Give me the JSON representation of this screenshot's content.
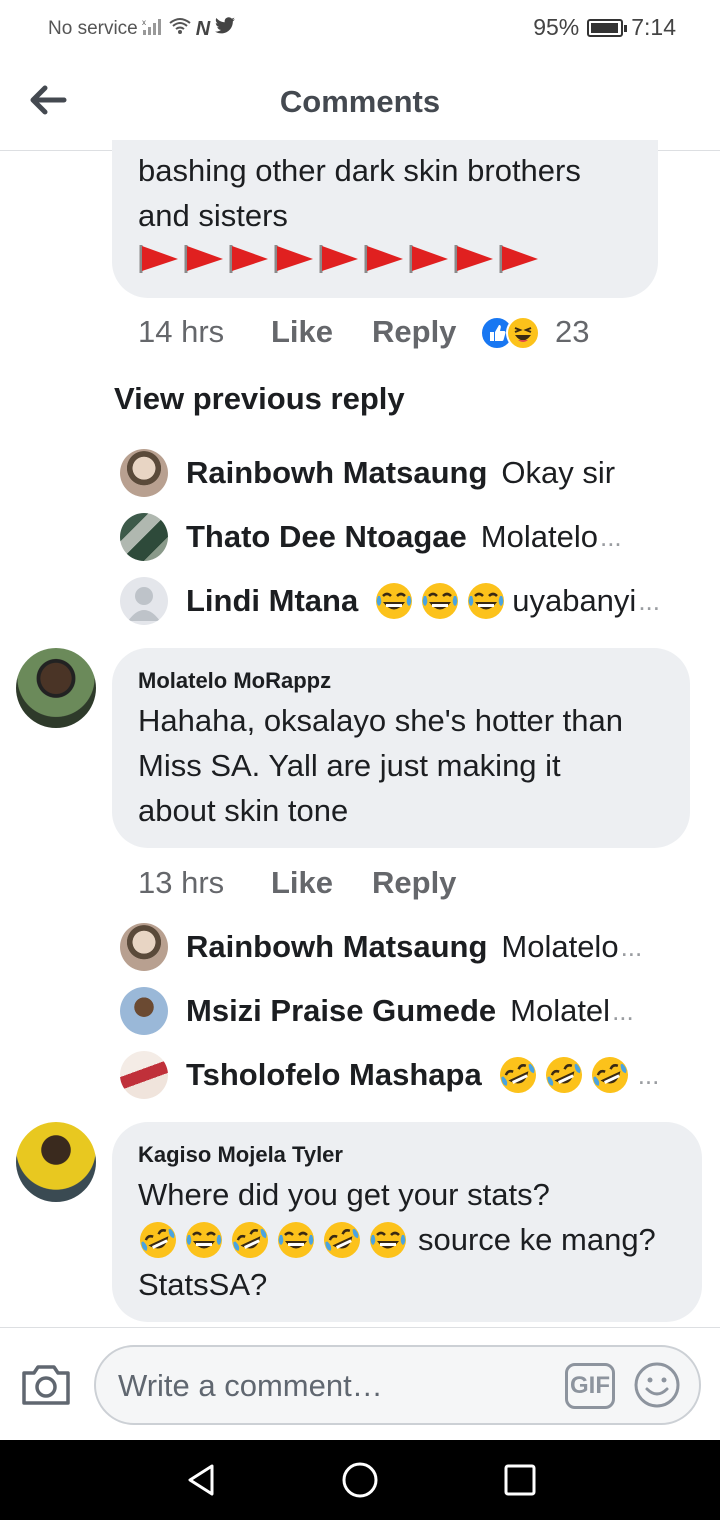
{
  "status_bar": {
    "carrier": "No service",
    "battery": "95%",
    "battery_level": 0.95,
    "time": "7:14"
  },
  "header": {
    "title": "Comments",
    "back_icon": "arrow-left-icon"
  },
  "comment_top": {
    "text_lines": [
      "bashing other dark skin brothers",
      "and sisters"
    ],
    "flag_count": 9,
    "time": "14 hrs",
    "like_label": "Like",
    "reply_label": "Reply",
    "reaction_count": "23"
  },
  "view_previous_reply": "View previous reply",
  "replies_1": [
    {
      "name": "Rainbowh Matsaung",
      "text": "Okay sir"
    },
    {
      "name": "Thato Dee Ntoagae",
      "text": "Molatelo"
    },
    {
      "name": "Lindi Mtana",
      "text": "uyabanyi"
    }
  ],
  "comment_2": {
    "author": "Molatelo MoRappz",
    "text_lines": [
      "Hahaha, oksalayo she's hotter than",
      "Miss SA. Yall are just making it",
      "about skin tone"
    ],
    "time": "13 hrs",
    "like_label": "Like",
    "reply_label": "Reply"
  },
  "replies_2": [
    {
      "name": "Rainbowh Matsaung",
      "text": "Molatelo"
    },
    {
      "name": "Msizi Praise Gumede",
      "text": "Molatel"
    },
    {
      "name": "Tsholofelo Mashapa",
      "text": ""
    }
  ],
  "comment_3": {
    "author": "Kagiso Mojela Tyler",
    "line1": "Where did you get your stats?",
    "line2": "source ke mang?",
    "line3": "StatsSA?"
  },
  "composer": {
    "placeholder": "Write a comment…",
    "gif_label": "GIF"
  },
  "colors": {
    "bubble": "#edeff2",
    "meta": "#65676b",
    "flag": "#e02020",
    "emoji_yellow": "#fcc21b",
    "like_blue": "#1877f2"
  }
}
